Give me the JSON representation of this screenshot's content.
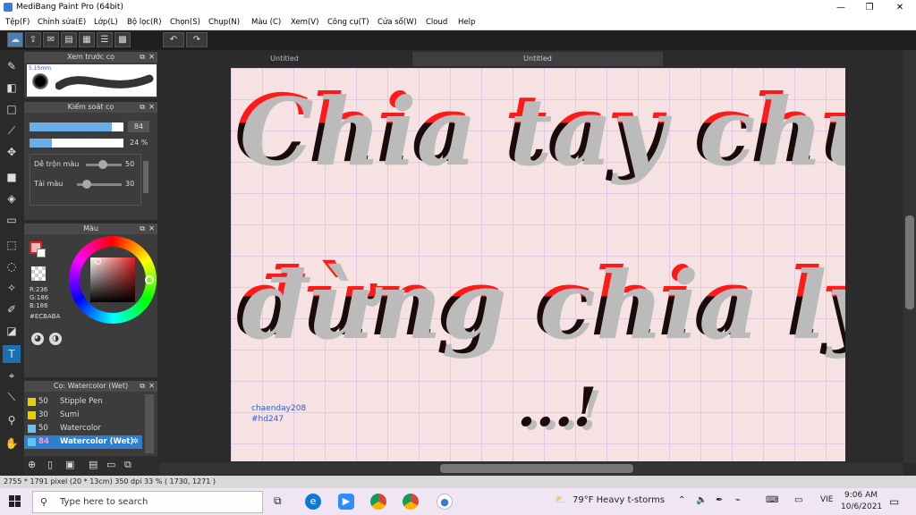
{
  "window": {
    "title": "MediBang Paint Pro (64bit)",
    "minimize": "—",
    "restore": "❐",
    "close": "✕"
  },
  "menu": [
    "Tệp(F)",
    "Chỉnh sửa(E)",
    "Lớp(L)",
    "Bộ lọc(R)",
    "Chọn(S)",
    "Chụp(N)",
    "Màu (C)",
    "Xem(V)",
    "Công cụ(T)",
    "Cửa sổ(W)",
    "Cloud",
    "Help"
  ],
  "tabs": [
    "Untitled",
    "Untitled"
  ],
  "panels": {
    "preview": {
      "title": "Xem trước cọ",
      "size_hint": "5,15mm"
    },
    "brush_control": {
      "title": "Kiểm soát cọ",
      "size_value": "84",
      "opacity_value": "24 %",
      "mix_label": "Dễ trộn màu",
      "mix_value": "50",
      "load_label": "Tải màu",
      "load_value": "30"
    },
    "color": {
      "title": "Màu",
      "r": "R:236",
      "g": "G:186",
      "b": "B:186",
      "hex": "#ECBABA"
    },
    "brushes": {
      "title": "Cọ: Watercolor (Wet)",
      "items": [
        {
          "size": "50",
          "name": "Stipple Pen"
        },
        {
          "size": "30",
          "name": "Sumi"
        },
        {
          "size": "50",
          "name": "Watercolor"
        },
        {
          "size": "84",
          "name": "Watercolor (Wet)"
        }
      ]
    }
  },
  "canvas": {
    "line1": "Chia tay chứ",
    "line2": "đừng chia ly",
    "line3": "...!",
    "credit1": "chaenday208",
    "credit2": "#hd247"
  },
  "status": {
    "text": "2755 * 1791 pixel   (20 * 13cm)   350 dpi   33 %   ( 1730, 1271 )"
  },
  "taskbar": {
    "search_placeholder": "Type here to search",
    "weather": "79°F  Heavy t-storms",
    "lang": "VIE",
    "time": "9:06 AM",
    "date": "10/6/2021"
  },
  "colors": {
    "accent": "#1e6fb0",
    "canvas_bg": "#f6e2e2",
    "fg_color": "#ECBABA"
  }
}
